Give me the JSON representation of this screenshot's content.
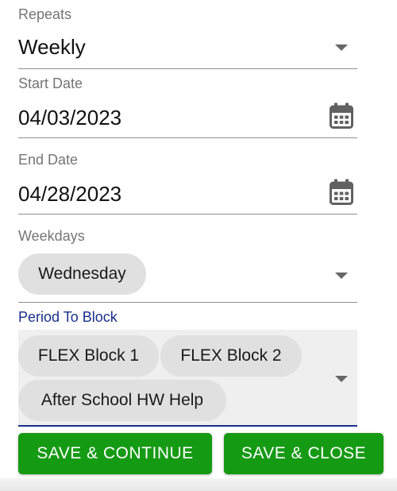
{
  "repeats": {
    "label": "Repeats",
    "value": "Weekly"
  },
  "start_date": {
    "label": "Start Date",
    "value": "04/03/2023"
  },
  "end_date": {
    "label": "End Date",
    "value": "04/28/2023"
  },
  "weekdays": {
    "label": "Weekdays",
    "chips": [
      "Wednesday"
    ]
  },
  "period_to_block": {
    "label": "Period To Block",
    "chips": [
      "FLEX Block 1",
      "FLEX Block 2",
      "After School HW Help"
    ]
  },
  "buttons": {
    "save_continue": "SAVE & CONTINUE",
    "save_close": "SAVE & CLOSE"
  },
  "colors": {
    "accent_label": "#1a2f8a",
    "button_bg": "#159a14",
    "chip_bg": "#e0e0e0",
    "field_bg": "#efefef"
  },
  "icons": {
    "dropdown": "chevron-down-icon",
    "calendar": "calendar-icon"
  }
}
